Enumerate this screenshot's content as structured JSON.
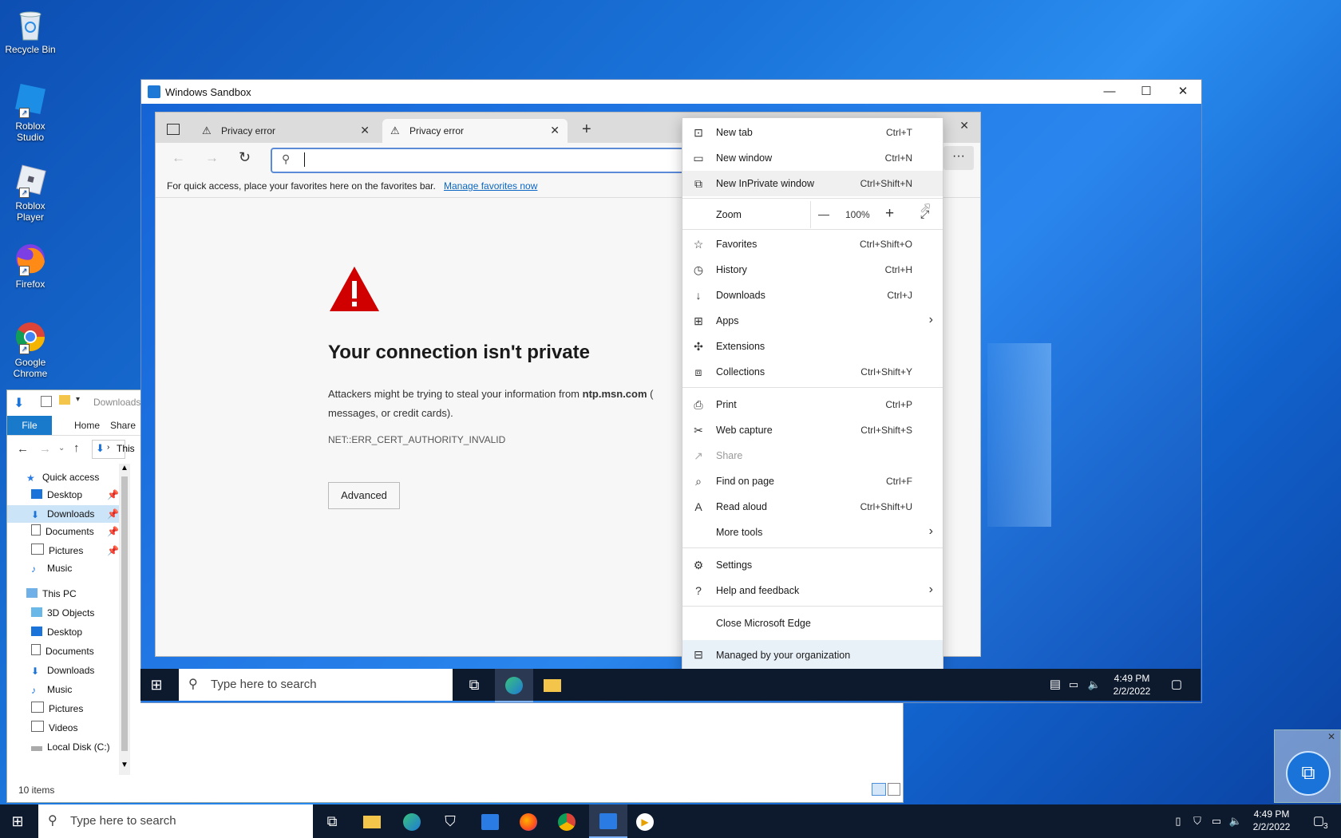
{
  "desktop": {
    "icons": [
      {
        "label": "Recycle Bin"
      },
      {
        "label": "Roblox Studio"
      },
      {
        "label": "Roblox Player"
      },
      {
        "label": "Firefox"
      },
      {
        "label": "Google Chrome"
      }
    ]
  },
  "sandbox": {
    "title": "Windows Sandbox",
    "minimize": "—",
    "maximize": "☐",
    "close": "✕"
  },
  "explorer": {
    "path": "Downloads",
    "tabs": {
      "file": "File",
      "home": "Home",
      "share": "Share"
    },
    "address": "This",
    "nav": {
      "quick_access": "Quick access",
      "qa_items": [
        "Desktop",
        "Downloads",
        "Documents",
        "Pictures",
        "Music"
      ],
      "this_pc": "This PC",
      "pc_items": [
        "3D Objects",
        "Desktop",
        "Documents",
        "Downloads",
        "Music",
        "Pictures",
        "Videos",
        "Local Disk (C:)"
      ]
    },
    "status": "10 items"
  },
  "edge": {
    "tabs": [
      {
        "label": "Privacy error"
      },
      {
        "label": "Privacy error"
      }
    ],
    "new_tab": "+",
    "close_window": "✕",
    "favorites_hint": "For quick access, place your favorites here on the favorites bar.",
    "manage_favorites": "Manage favorites now",
    "error": {
      "title": "Your connection isn't private",
      "body_prefix": "Attackers might be trying to steal your information from",
      "host": "ntp.msn.com",
      "body_suffix": "(",
      "body_line2": "messages, or credit cards).",
      "code": "NET::ERR_CERT_AUTHORITY_INVALID",
      "advanced": "Advanced"
    }
  },
  "menu": {
    "new_tab": {
      "label": "New tab",
      "shortcut": "Ctrl+T"
    },
    "new_window": {
      "label": "New window",
      "shortcut": "Ctrl+N"
    },
    "new_inprivate": {
      "label": "New InPrivate window",
      "shortcut": "Ctrl+Shift+N"
    },
    "zoom": {
      "label": "Zoom",
      "minus": "—",
      "value": "100%",
      "plus": "+"
    },
    "favorites": {
      "label": "Favorites",
      "shortcut": "Ctrl+Shift+O"
    },
    "history": {
      "label": "History",
      "shortcut": "Ctrl+H"
    },
    "downloads": {
      "label": "Downloads",
      "shortcut": "Ctrl+J"
    },
    "apps": {
      "label": "Apps"
    },
    "extensions": {
      "label": "Extensions"
    },
    "collections": {
      "label": "Collections",
      "shortcut": "Ctrl+Shift+Y"
    },
    "print": {
      "label": "Print",
      "shortcut": "Ctrl+P"
    },
    "web_capture": {
      "label": "Web capture",
      "shortcut": "Ctrl+Shift+S"
    },
    "share": {
      "label": "Share"
    },
    "find": {
      "label": "Find on page",
      "shortcut": "Ctrl+F"
    },
    "read_aloud": {
      "label": "Read aloud",
      "shortcut": "Ctrl+Shift+U"
    },
    "more_tools": {
      "label": "More tools"
    },
    "settings": {
      "label": "Settings"
    },
    "help": {
      "label": "Help and feedback"
    },
    "close_edge": {
      "label": "Close Microsoft Edge"
    },
    "managed": {
      "label": "Managed by your organization"
    }
  },
  "inner_taskbar": {
    "search_placeholder": "Type here to search",
    "time": "4:49 PM",
    "date": "2/2/2022"
  },
  "outer_taskbar": {
    "search_placeholder": "Type here to search",
    "time": "4:49 PM",
    "date": "2/2/2022",
    "notification_count": "3"
  }
}
